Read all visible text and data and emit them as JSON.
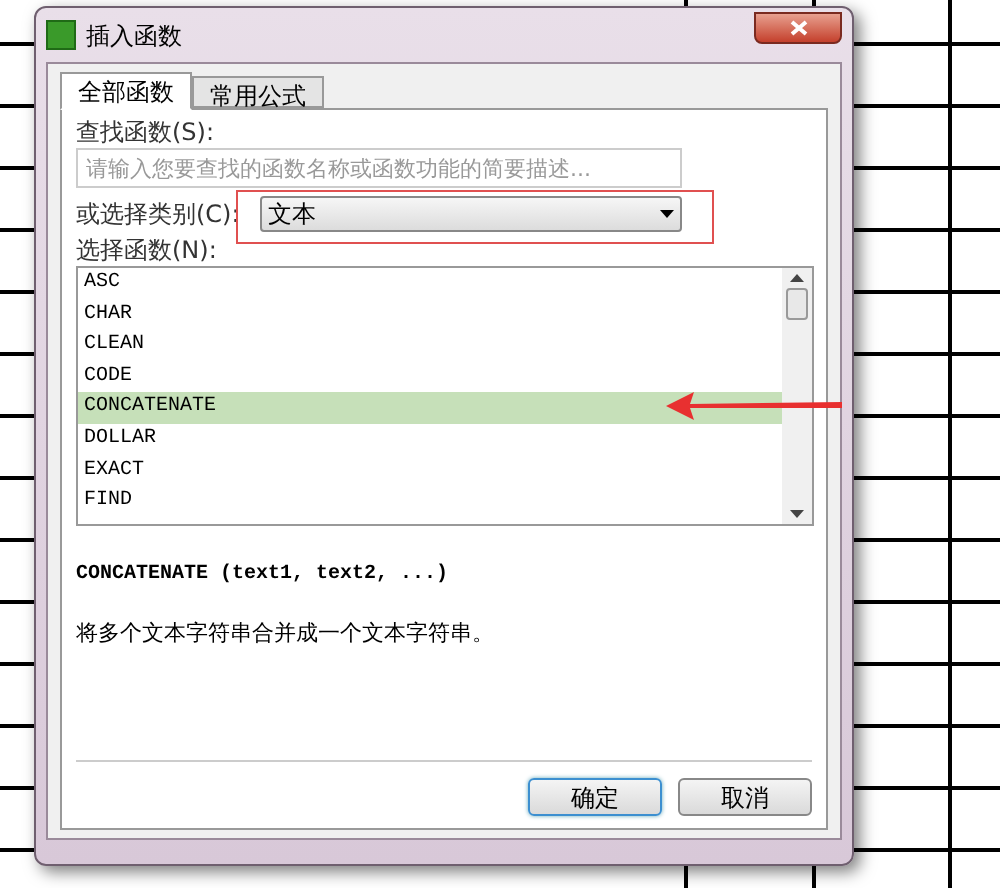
{
  "window": {
    "title": "插入函数"
  },
  "tabs": [
    {
      "label": "全部函数",
      "selected": true
    },
    {
      "label": "常用公式",
      "selected": false
    }
  ],
  "search": {
    "label": "查找函数(S):",
    "placeholder": "请输入您要查找的函数名称或函数功能的简要描述..."
  },
  "category": {
    "label": "或选择类别(C):",
    "value": "文本"
  },
  "function_list": {
    "label": "选择函数(N):",
    "items": [
      {
        "name": "ASC",
        "selected": false
      },
      {
        "name": "CHAR",
        "selected": false
      },
      {
        "name": "CLEAN",
        "selected": false
      },
      {
        "name": "CODE",
        "selected": false
      },
      {
        "name": "CONCATENATE",
        "selected": true
      },
      {
        "name": "DOLLAR",
        "selected": false
      },
      {
        "name": "EXACT",
        "selected": false
      },
      {
        "name": "FIND",
        "selected": false
      }
    ]
  },
  "signature": "CONCATENATE (text1, text2, ...)",
  "description": "将多个文本字符串合并成一个文本字符串。",
  "buttons": [
    {
      "label": "确定",
      "kind": "default"
    },
    {
      "label": "取消",
      "kind": "normal"
    }
  ]
}
